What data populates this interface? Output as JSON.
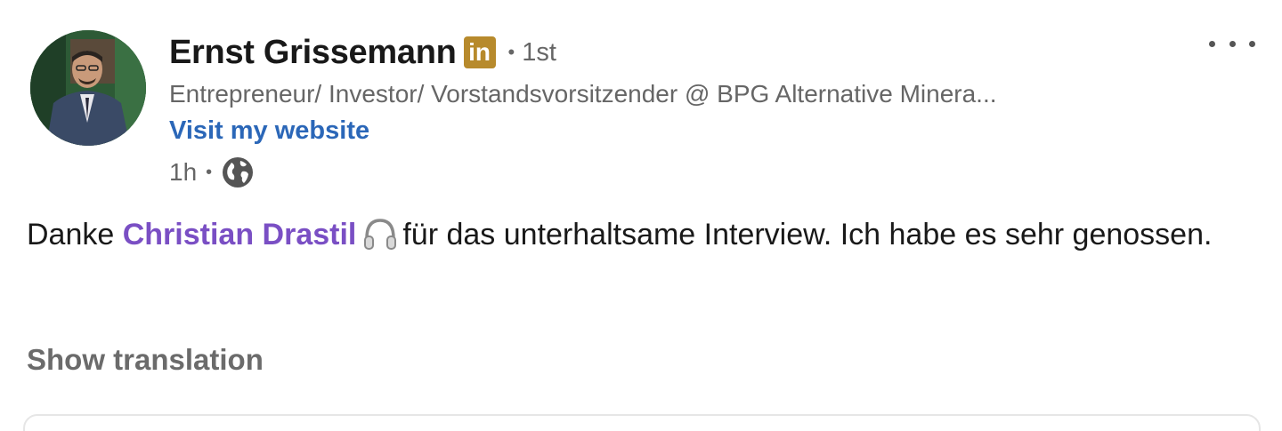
{
  "author": {
    "name": "Ernst Grissemann",
    "badge": "in",
    "degree": "1st",
    "headline": "Entrepreneur/ Investor/ Vorstandsvorsitzender @ BPG Alternative Minera...",
    "website_label": "Visit my website",
    "posted": "1h",
    "separator": "•"
  },
  "post": {
    "text_before": "Danke ",
    "mention": "Christian Drastil",
    "text_after": "für das unterhaltsame Interview. Ich habe es sehr genossen.",
    "show_translation": "Show translation"
  },
  "colors": {
    "link": "#2b67b8",
    "mention": "#7a4fc4",
    "linkedin_badge": "#b78a2c",
    "muted": "#666666"
  },
  "icons": {
    "visibility": "globe-icon",
    "menu": "more-horizontal-icon",
    "emoji": "headphones-icon"
  }
}
